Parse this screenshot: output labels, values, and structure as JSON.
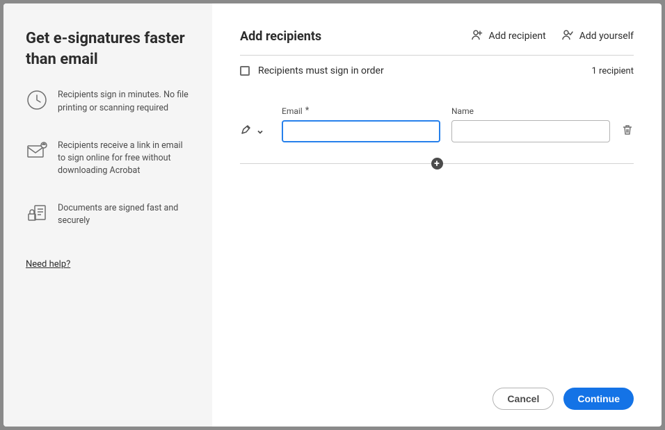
{
  "sidebar": {
    "title": "Get e-signatures faster than email",
    "benefits": [
      {
        "text": "Recipients sign in minutes. No file printing or scanning required"
      },
      {
        "text": "Recipients receive a link in email to sign online for free without downloading Acrobat"
      },
      {
        "text": "Documents are signed fast and securely"
      }
    ],
    "help_link": "Need help?"
  },
  "main": {
    "title": "Add recipients",
    "actions": {
      "add_recipient": "Add recipient",
      "add_yourself": "Add yourself"
    },
    "options": {
      "sign_in_order_label": "Recipients must sign in order",
      "recipient_count": "1 recipient"
    },
    "form": {
      "email_label": "Email",
      "name_label": "Name",
      "email_value": "",
      "name_value": ""
    },
    "footer": {
      "cancel": "Cancel",
      "continue": "Continue"
    }
  }
}
